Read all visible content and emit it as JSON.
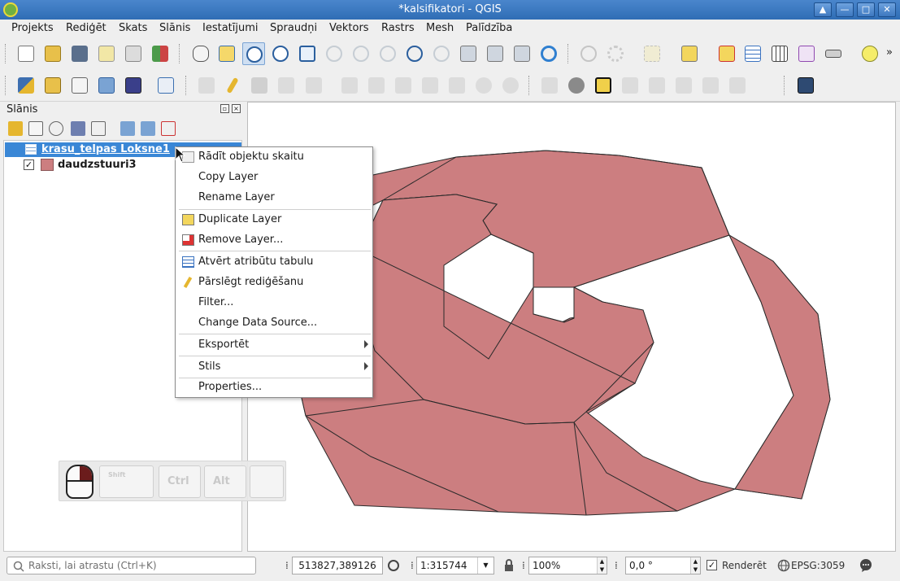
{
  "window": {
    "title": "*kalsifikatori - QGIS"
  },
  "menu": [
    "Projekts",
    "Rediģēt",
    "Skats",
    "Slānis",
    "Iestatījumi",
    "Spraudņi",
    "Vektors",
    "Rastrs",
    "Mesh",
    "Palīdzība"
  ],
  "toolbar_overflow": "»",
  "layers_panel": {
    "title": "Slānis",
    "layers": [
      {
        "name": "krasu_telpas Loksne1",
        "type": "table",
        "checked": false,
        "selected": true
      },
      {
        "name": "daudzstuuri3",
        "type": "polygon",
        "checked": true,
        "selected": false,
        "color": "#cc7e80"
      }
    ]
  },
  "context_menu": {
    "items": [
      {
        "label": "Rādīt objektu skaitu",
        "icon": "count-icon"
      },
      {
        "label": "Copy Layer"
      },
      {
        "label": "Rename Layer"
      },
      {
        "label": "Duplicate Layer",
        "icon": "duplicate-icon"
      },
      {
        "label": "Remove Layer...",
        "icon": "remove-layer-icon"
      },
      {
        "label": "Atvērt atribūtu tabulu",
        "icon": "attribute-table-icon"
      },
      {
        "label": "Pārslēgt rediģēšanu",
        "icon": "pencil-icon"
      },
      {
        "label": "Filter..."
      },
      {
        "label": "Change Data Source..."
      },
      {
        "label": "Eksportēt",
        "submenu": true
      },
      {
        "label": "Stils",
        "submenu": true
      },
      {
        "label": "Properties..."
      }
    ]
  },
  "keyboard_overlay": {
    "keys": [
      "Shift",
      "Ctrl",
      "Alt",
      ""
    ]
  },
  "statusbar": {
    "search_placeholder": "Raksti, lai atrastu (Ctrl+K)",
    "coordinate": "513827,389126",
    "scale": "1:315744",
    "magnifier": "100%",
    "rotation": "0,0 °",
    "render_label": "Renderēt",
    "render_checked": true,
    "crs": "EPSG:3059"
  },
  "colors": {
    "polygon_fill": "#cc7e80",
    "selection": "#3a87d6",
    "titlebar": "#3b77bf"
  }
}
